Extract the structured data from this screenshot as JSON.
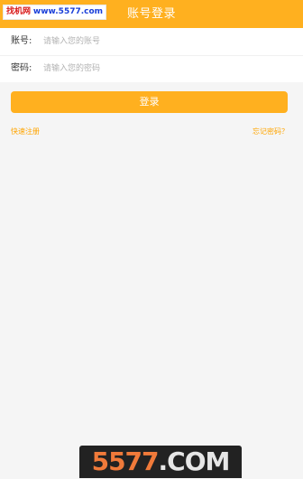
{
  "header": {
    "title": "账号登录"
  },
  "watermark_top": {
    "brand": "找机网",
    "url": "www.5577.com"
  },
  "form": {
    "account": {
      "label": "账号:",
      "placeholder": "请输入您的账号",
      "value": ""
    },
    "password": {
      "label": "密码:",
      "placeholder": "请输入您的密码",
      "value": ""
    }
  },
  "login_button": {
    "label": "登录"
  },
  "links": {
    "register": "快速注册",
    "forgot": "忘记密码？"
  },
  "watermark_bottom": {
    "num": "5577",
    "com": ".COM"
  },
  "colors": {
    "accent": "#ffb01f",
    "link": "#ffa500",
    "background": "#f5f5f5"
  }
}
